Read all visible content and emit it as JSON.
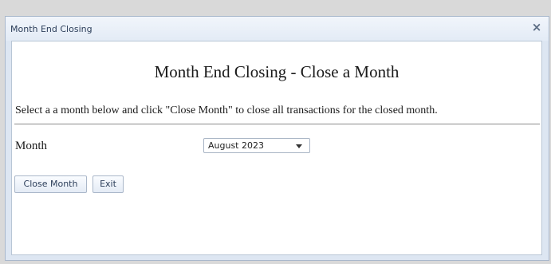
{
  "window": {
    "title": "Month End Closing",
    "close_glyph": "×",
    "close_icon": "close-icon"
  },
  "main": {
    "heading": "Month End Closing - Close a Month",
    "instructions": "Select a a month below and click \"Close Month\" to close all transactions for the closed month.",
    "month_label": "Month",
    "month_select": {
      "selected": "August 2023",
      "arrow_icon": "chevron-down-icon"
    }
  },
  "buttons": {
    "close_month": "Close Month",
    "exit": "Exit"
  }
}
